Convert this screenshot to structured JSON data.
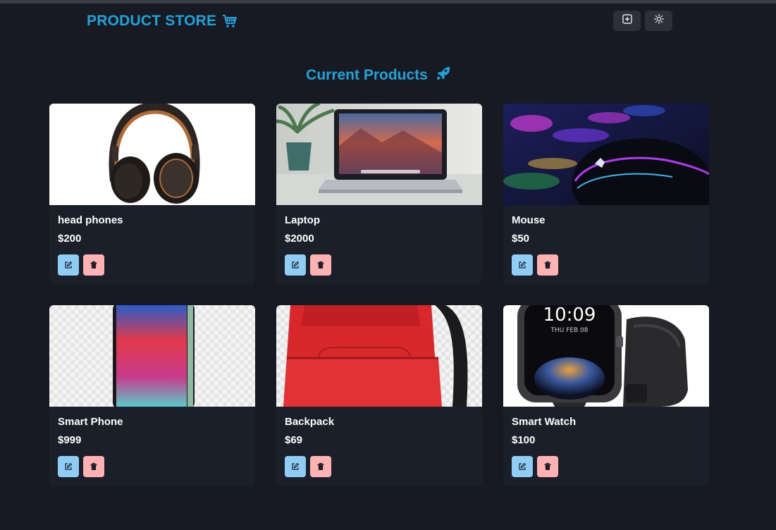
{
  "header": {
    "brand": "PRODUCT STORE",
    "brand_icon": "shopping-cart-icon",
    "buttons": [
      {
        "name": "create-product-button",
        "icon": "plus-square-icon"
      },
      {
        "name": "toggle-theme-button",
        "icon": "sun-icon"
      }
    ]
  },
  "main": {
    "title": "Current Products",
    "title_icon": "rocket-icon"
  },
  "products": [
    {
      "name": "head phones",
      "price": "$200",
      "image": "headphones"
    },
    {
      "name": "Laptop",
      "price": "$2000",
      "image": "laptop"
    },
    {
      "name": "Mouse",
      "price": "$50",
      "image": "mouse"
    },
    {
      "name": "Smart Phone",
      "price": "$999",
      "image": "smartphone"
    },
    {
      "name": "Backpack",
      "price": "$69",
      "image": "backpack"
    },
    {
      "name": "Smart Watch",
      "price": "$100",
      "image": "smartwatch"
    }
  ],
  "watch_time": "10:09",
  "watch_date": "THU FEB 08",
  "colors": {
    "background": "#171923",
    "card": "#1b1f2a",
    "accent": "#1fa3d9",
    "edit_button": "#90cdf4",
    "delete_button": "#feb2b2"
  }
}
